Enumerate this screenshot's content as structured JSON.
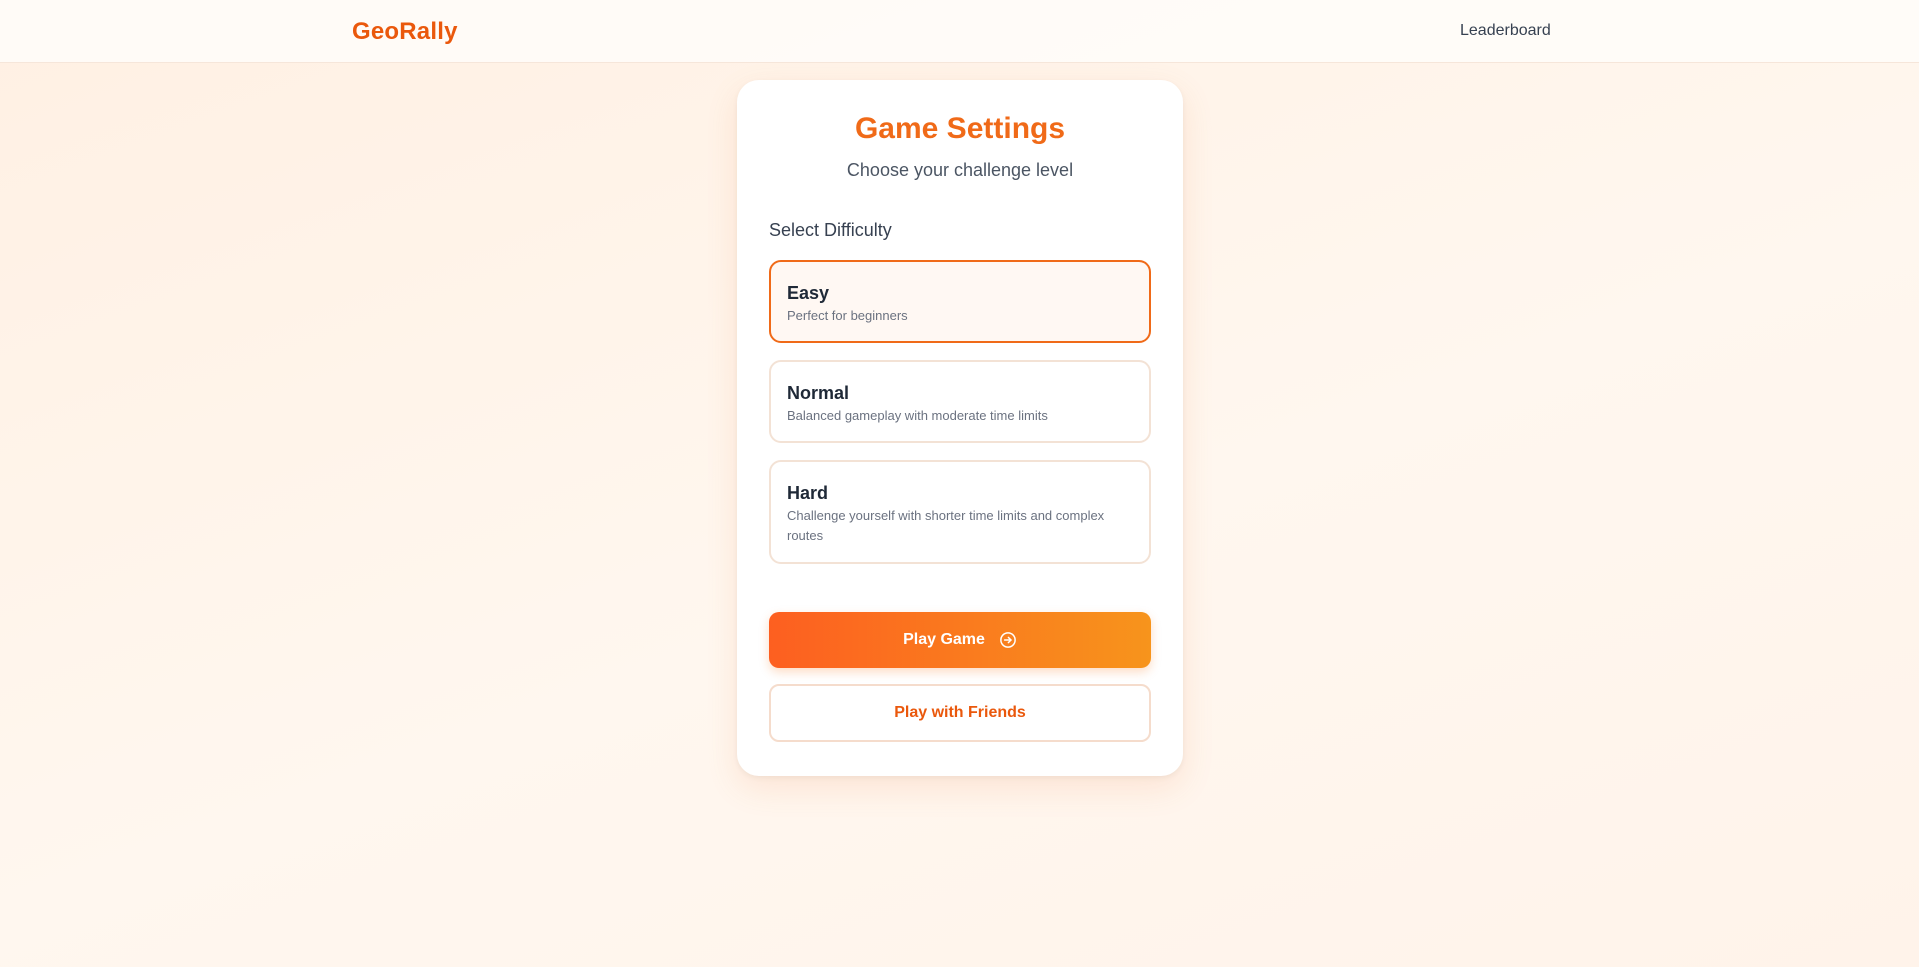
{
  "header": {
    "brand": "GeoRally",
    "nav_leaderboard": "Leaderboard"
  },
  "settings": {
    "title": "Game Settings",
    "subtitle": "Choose your challenge level",
    "difficulty_label": "Select Difficulty",
    "options": [
      {
        "title": "Easy",
        "description": "Perfect for beginners",
        "selected": true
      },
      {
        "title": "Normal",
        "description": "Balanced gameplay with moderate time limits",
        "selected": false
      },
      {
        "title": "Hard",
        "description": "Challenge yourself with shorter time limits and complex routes",
        "selected": false
      }
    ],
    "play_button": "Play Game",
    "play_button_icon": "arrow-circle-right-icon",
    "friends_button": "Play with Friends"
  },
  "colors": {
    "accent": "#ea580c",
    "gradient_start": "#fd5f20",
    "gradient_end": "#f7941c",
    "page_background": "#fff3e8"
  }
}
